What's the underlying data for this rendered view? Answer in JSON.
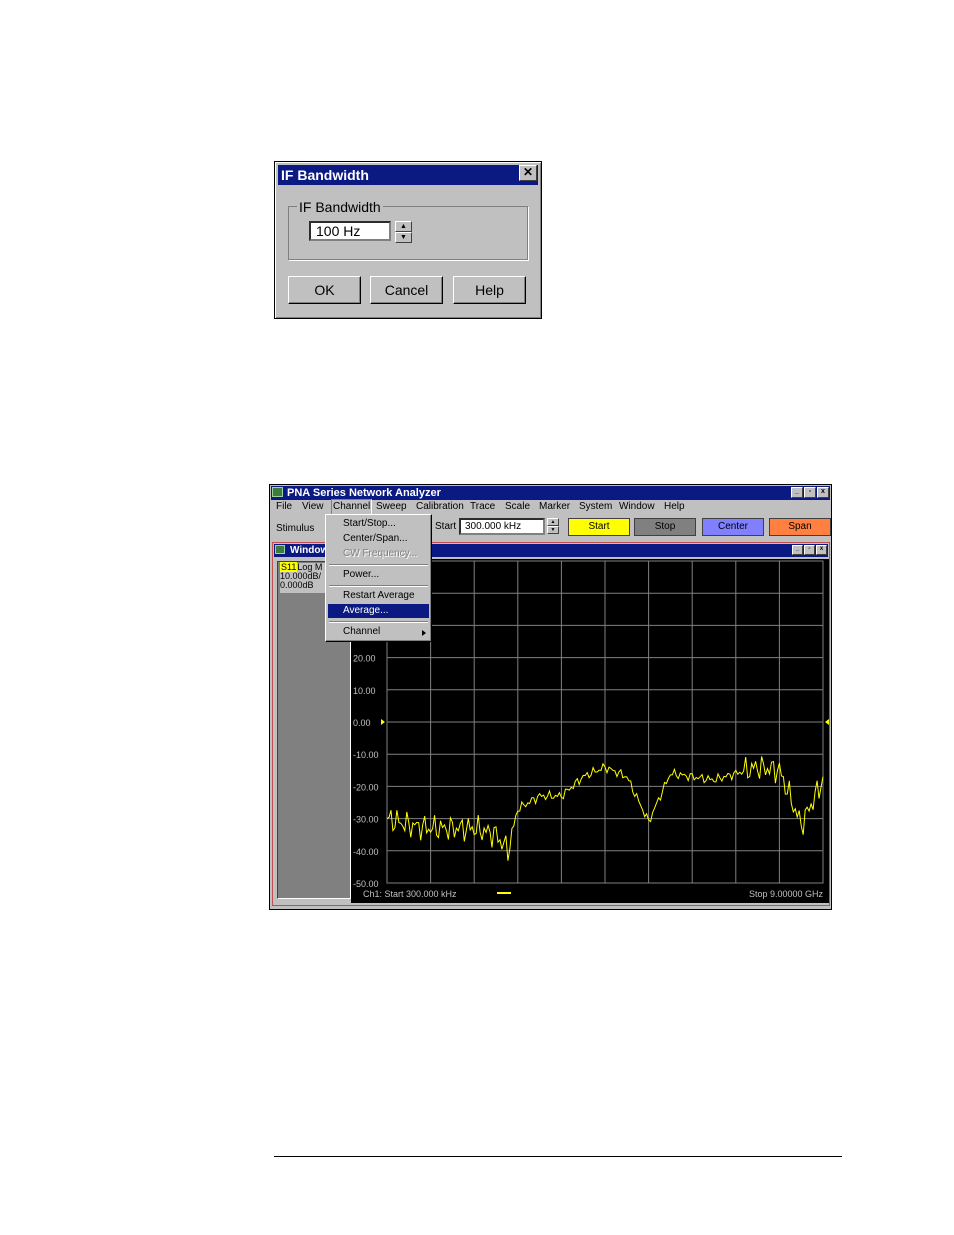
{
  "dialog": {
    "title": "IF Bandwidth",
    "close_glyph": "✕",
    "group_label": "IF Bandwidth",
    "value": "100 Hz",
    "buttons": {
      "ok": "OK",
      "cancel": "Cancel",
      "help": "Help"
    }
  },
  "pna": {
    "title": "PNA Series Network Analyzer",
    "menu": [
      "File",
      "View",
      "Channel",
      "Sweep",
      "Calibration",
      "Trace",
      "Scale",
      "Marker",
      "System",
      "Window",
      "Help"
    ],
    "toolbar": {
      "stimulus": "Stimulus",
      "start_label": "Start",
      "start_value": "300.000 kHz",
      "buttons": [
        {
          "label": "Start",
          "color": "#ffff00"
        },
        {
          "label": "Stop",
          "color": "#808080"
        },
        {
          "label": "Center",
          "color": "#8080ff"
        },
        {
          "label": "Span",
          "color": "#ff8040"
        }
      ]
    },
    "channel_window": {
      "title": "Window",
      "trace_param": "S11",
      "trace_format": "Log M",
      "scale": "10.000dB/",
      "ref": "0.000dB"
    },
    "channel_menu": {
      "items": [
        "Start/Stop...",
        "Center/Span...",
        "CW Frequency...",
        "Power...",
        "Restart Average",
        "Average...",
        "Channel"
      ],
      "disabled": "CW Frequency...",
      "selected": "Average..."
    },
    "footer": {
      "start": "Ch1: Start  300.000 kHz",
      "stop": "Stop  9.00000 GHz"
    }
  },
  "chart_data": {
    "type": "line",
    "title": "",
    "xlabel": "",
    "ylabel": "",
    "y_tick_labels": [
      "20.00",
      "10.00",
      "0.00",
      "-10.00",
      "-20.00",
      "-30.00",
      "-40.00",
      "-50.00"
    ],
    "ylim": [
      -50,
      50
    ],
    "xlim_ghz": [
      0.0003,
      9.0
    ],
    "grid": true,
    "series": [
      {
        "color": "#ffff00",
        "x": [
          0.0,
          0.45,
          0.9,
          1.35,
          1.8,
          2.25,
          2.5,
          2.7,
          3.15,
          3.6,
          4.05,
          4.5,
          4.95,
          5.4,
          5.85,
          6.3,
          6.75,
          7.2,
          7.65,
          8.1,
          8.55,
          9.0
        ],
        "y": [
          -30,
          -32,
          -33,
          -33,
          -33,
          -35,
          -40,
          -27,
          -23,
          -23,
          -17,
          -14,
          -17,
          -31,
          -16,
          -17,
          -18,
          -16,
          -14,
          -15,
          -32,
          -18
        ]
      }
    ]
  }
}
